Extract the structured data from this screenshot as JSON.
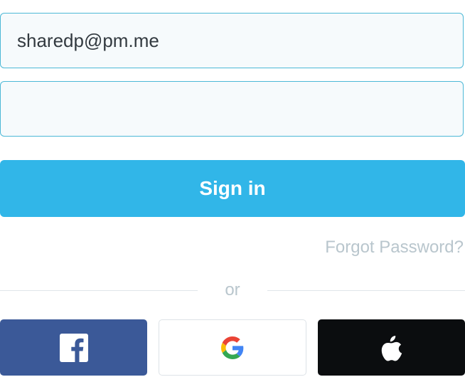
{
  "login": {
    "email_value": "sharedp@pm.me",
    "password_value": "",
    "signin_label": "Sign in",
    "forgot_label": "Forgot Password?",
    "or_label": "or"
  },
  "social": {
    "facebook_icon": "facebook-icon",
    "google_icon": "google-icon",
    "apple_icon": "apple-icon"
  },
  "colors": {
    "accent": "#31b6e8",
    "field_border": "#4cb8d6",
    "muted_text": "#b9c6cd",
    "facebook": "#3b5998",
    "apple": "#0b0d0f"
  }
}
